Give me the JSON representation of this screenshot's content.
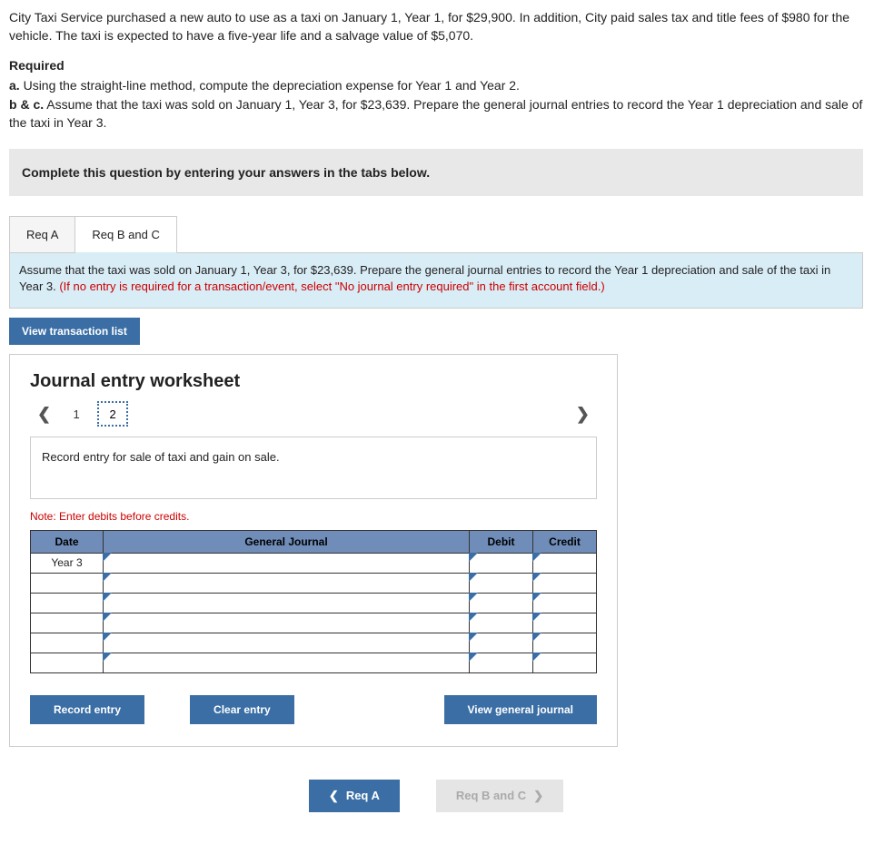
{
  "problem": {
    "p1": "City Taxi Service purchased a new auto to use as a taxi on January 1, Year 1, for $29,900. In addition, City paid sales tax and title fees of $980 for the vehicle. The taxi is expected to have a five-year life and a salvage value of $5,070.",
    "required_hdr": "Required",
    "a_prefix": "a.",
    "a_text": " Using the straight-line method, compute the depreciation expense for Year 1 and Year 2.",
    "bc_prefix": "b & c.",
    "bc_text": " Assume that the taxi was sold on January 1, Year 3, for $23,639. Prepare the general journal entries to record the Year 1 depreciation and sale of the taxi in Year 3."
  },
  "instruction": "Complete this question by entering your answers in the tabs below.",
  "tabs": {
    "a": "Req A",
    "bc": "Req B and C"
  },
  "panel": {
    "text": "Assume that the taxi was sold on January 1, Year 3, for $23,639. Prepare the general journal entries to record the Year 1 depreciation and sale of the taxi in Year 3. ",
    "red": "(If no entry is required for a transaction/event, select \"No journal entry required\" in the first account field.)"
  },
  "view_txn": "View transaction list",
  "worksheet": {
    "title": "Journal entry worksheet",
    "pages": {
      "p1": "1",
      "p2": "2"
    },
    "prompt": "Record entry for sale of taxi and gain on sale.",
    "note": "Note: Enter debits before credits.",
    "headers": {
      "date": "Date",
      "gj": "General Journal",
      "debit": "Debit",
      "credit": "Credit"
    },
    "row1_date": "Year 3",
    "buttons": {
      "record": "Record entry",
      "clear": "Clear entry",
      "view": "View general journal"
    }
  },
  "nav": {
    "prev": "Req A",
    "next": "Req B and C"
  }
}
